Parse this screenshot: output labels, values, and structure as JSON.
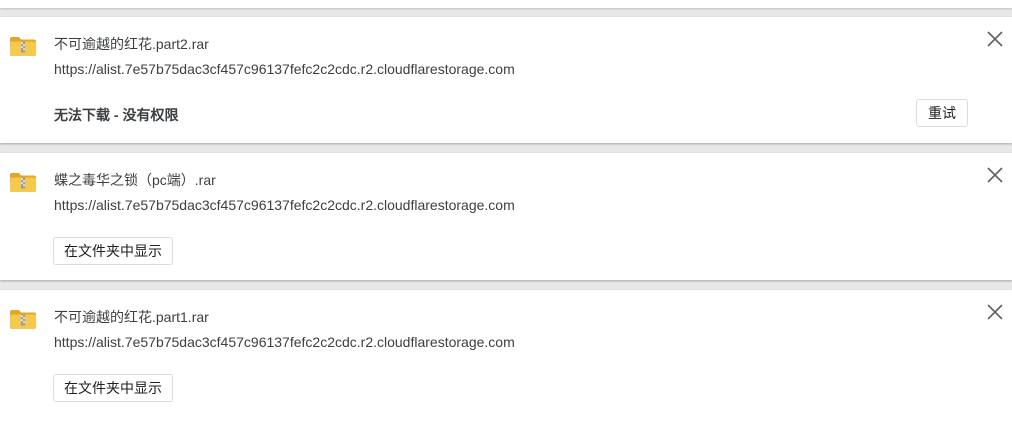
{
  "downloads": [
    {
      "name": "不可逾越的红花.part2.rar",
      "url": "https://alist.7e57b75dac3cf457c96137fefc2c2cdc.r2.cloudflarestorage.com",
      "status": "无法下载 - 没有权限",
      "action_label": "重试",
      "icon": "zip-folder-icon"
    },
    {
      "name": "蝶之毒华之锁（pc端）.rar",
      "url": "https://alist.7e57b75dac3cf457c96137fefc2c2cdc.r2.cloudflarestorage.com",
      "action_label": "在文件夹中显示",
      "icon": "zip-folder-icon"
    },
    {
      "name": "不可逾越的红花.part1.rar",
      "url": "https://alist.7e57b75dac3cf457c96137fefc2c2cdc.r2.cloudflarestorage.com",
      "action_label": "在文件夹中显示",
      "icon": "zip-folder-icon"
    }
  ],
  "colors": {
    "folder": "#f4c94e",
    "folder_dark": "#e0a82a",
    "text": "#3c4043",
    "background": "#e8e8e8"
  }
}
